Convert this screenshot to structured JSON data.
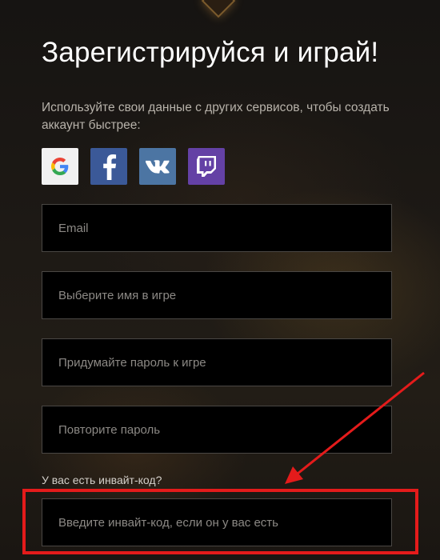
{
  "header": {
    "title": "Зарегистрируйся и играй!",
    "hint": "Используйте свои данные с других сервисов, чтобы создать аккаунт быстрее:"
  },
  "social": [
    {
      "name": "google",
      "icon": "google-icon",
      "color": "#f1f1f1"
    },
    {
      "name": "facebook",
      "icon": "facebook-icon",
      "color": "#3b5998"
    },
    {
      "name": "vk",
      "icon": "vk-icon",
      "color": "#4c75a3"
    },
    {
      "name": "twitch",
      "icon": "twitch-icon",
      "color": "#6441a5"
    }
  ],
  "form": {
    "email_placeholder": "Email",
    "nickname_placeholder": "Выберите имя в игре",
    "password_placeholder": "Придумайте пароль к игре",
    "password_repeat_placeholder": "Повторите пароль",
    "invite_label": "У вас есть инвайт-код?",
    "invite_placeholder": "Введите инвайт-код, если он у вас есть"
  },
  "annotation": {
    "highlight_color": "#e41b1b"
  }
}
